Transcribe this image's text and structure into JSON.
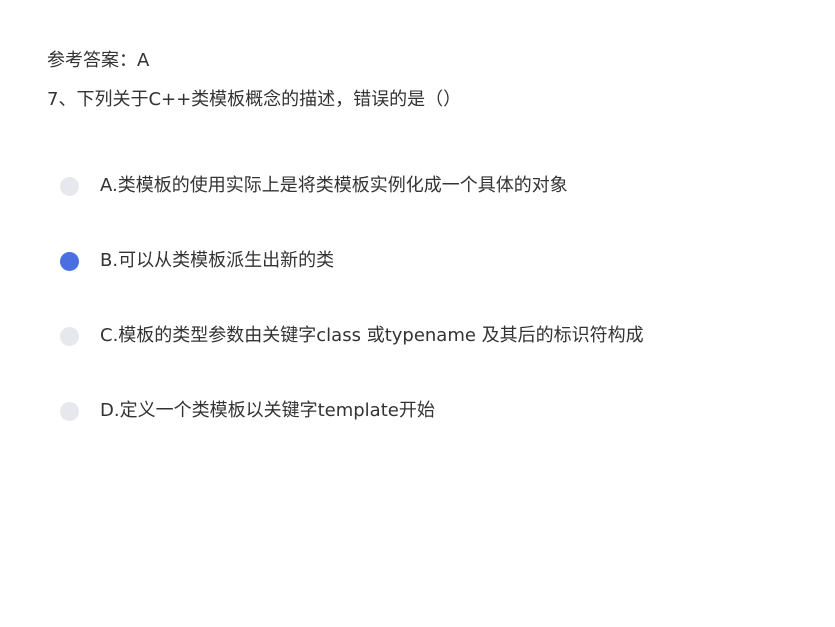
{
  "answer_reference": "参考答案：A",
  "question": {
    "text": "7、下列关于C++类模板概念的描述，错误的是（）"
  },
  "options": [
    {
      "label": "A.类模板的使用实际上是将类模板实例化成一个具体的对象",
      "selected": false
    },
    {
      "label": "B.可以从类模板派生出新的类",
      "selected": true
    },
    {
      "label": "C.模板的类型参数由关键字class 或typename 及其后的标识符构成",
      "selected": false
    },
    {
      "label": "D.定义一个类模板以关键字template开始",
      "selected": false
    }
  ],
  "colors": {
    "radio_selected": "#4a6fe3",
    "radio_unselected": "#e7e8ee",
    "text": "#333333"
  }
}
